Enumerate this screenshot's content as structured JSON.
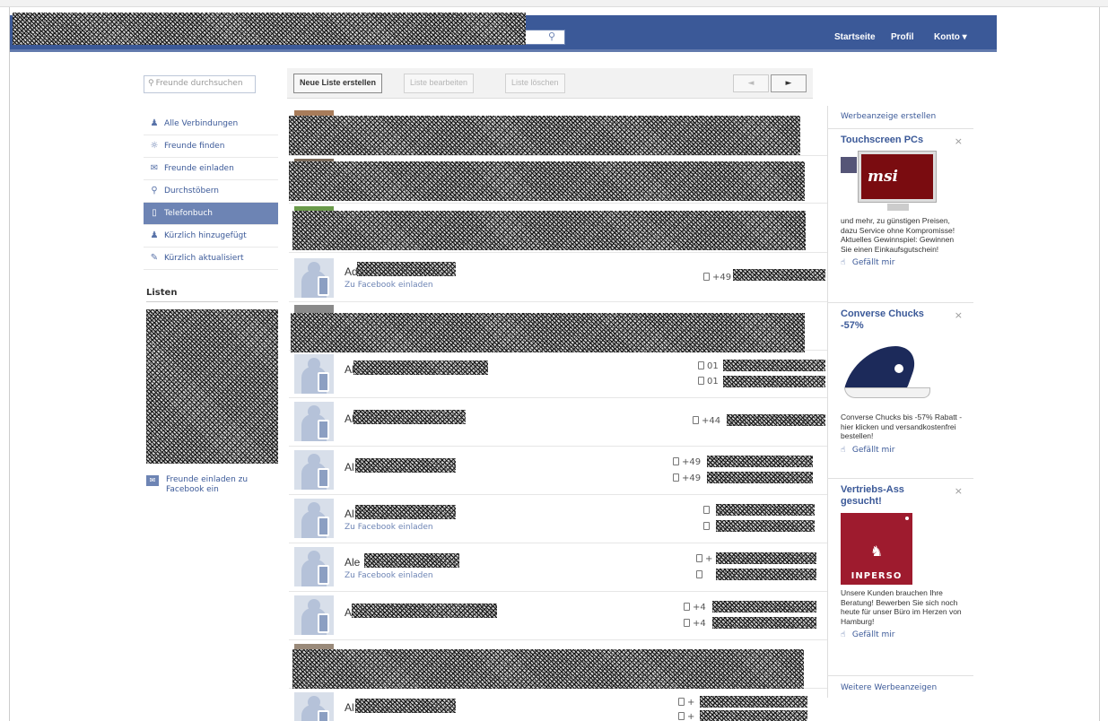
{
  "header": {
    "nav": [
      "Startseite",
      "Profil",
      "Konto ▾"
    ]
  },
  "sidebar": {
    "search_placeholder": "Freunde durchsuchen",
    "items": [
      {
        "label": "Alle Verbindungen",
        "icon": "people-icon"
      },
      {
        "label": "Freunde finden",
        "icon": "find-friends-icon"
      },
      {
        "label": "Freunde einladen",
        "icon": "invite-icon"
      },
      {
        "label": "Durchstöbern",
        "icon": "magnifier-icon"
      },
      {
        "label": "Telefonbuch",
        "icon": "phonebook-icon"
      },
      {
        "label": "Kürzlich hinzugefügt",
        "icon": "recently-added-icon"
      },
      {
        "label": "Kürzlich aktualisiert",
        "icon": "pencil-icon"
      }
    ],
    "lists_heading": "Listen",
    "invite_text": "Freunde einladen zu Facebook ein"
  },
  "toolbar": {
    "new_list": "Neue Liste erstellen",
    "edit_list": "Liste bearbeiten",
    "delete_list": "Liste löschen",
    "prev": "◄",
    "next": "►"
  },
  "contacts": {
    "invite_label": "Zu Facebook einladen",
    "rows": [
      {
        "name_visible": "Ad",
        "invite": true,
        "phones": [
          "+49"
        ]
      },
      {
        "name_visible": "Al",
        "invite": false,
        "phones": [
          "01",
          "01"
        ]
      },
      {
        "name_visible": "Al",
        "invite": false,
        "phones": [
          "+44"
        ]
      },
      {
        "name_visible": "Al",
        "invite": false,
        "phones": [
          "+49",
          "+49"
        ]
      },
      {
        "name_visible": "Al",
        "invite": true,
        "phones": [
          "",
          ""
        ]
      },
      {
        "name_visible": "Ale",
        "invite": true,
        "phones": [
          "+",
          ""
        ]
      },
      {
        "name_visible": "A",
        "invite": false,
        "phones": [
          "+4",
          "+4"
        ]
      },
      {
        "name_visible": "Al",
        "invite": false,
        "phones": [
          "+",
          "+"
        ]
      }
    ]
  },
  "ads": {
    "create_label": "Werbeanzeige erstellen",
    "like_label": "Gefällt mir",
    "more_label": "Weitere Werbeanzeigen",
    "close": "×",
    "items": [
      {
        "title": "Touchscreen PCs",
        "image_brand": "msi",
        "text": "und mehr, zu günstigen Preisen, dazu Service ohne Kompromisse! Aktuelles Gewinnspiel: Gewinnen Sie einen Einkaufsgutschein!"
      },
      {
        "title": "Converse Chucks -57%",
        "text": "Converse Chucks bis -57% Rabatt - hier klicken und versandkostenfrei bestellen!"
      },
      {
        "title": "Vertriebs-Ass gesucht!",
        "image_brand": "INPERSO",
        "text": "Unsere Kunden brauchen Ihre Beratung! Bewerben Sie sich noch heute für unser Büro im Herzen von Hamburg!"
      }
    ]
  },
  "colors": {
    "topbar": "#3b5998",
    "active_item": "#6d84b4",
    "link": "#3b5998"
  }
}
